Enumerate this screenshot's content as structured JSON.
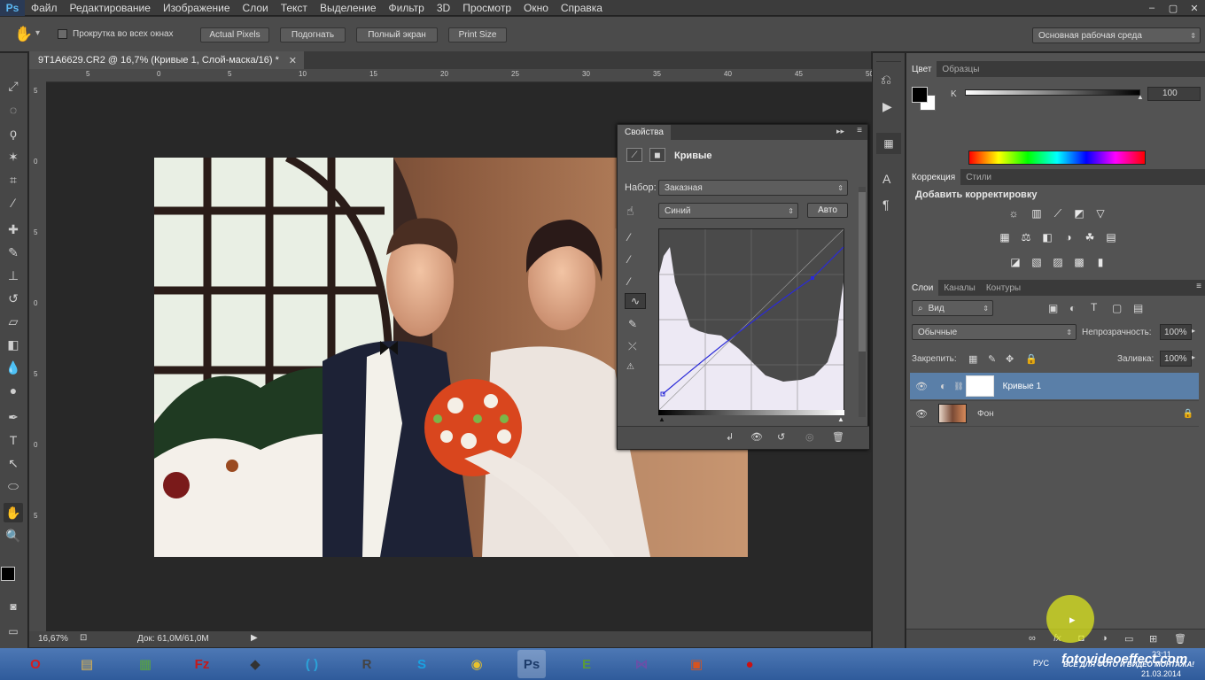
{
  "app": {
    "logo": "Ps"
  },
  "menu": [
    "Файл",
    "Редактирование",
    "Изображение",
    "Слои",
    "Текст",
    "Выделение",
    "Фильтр",
    "3D",
    "Просмотр",
    "Окно",
    "Справка"
  ],
  "window_controls": [
    "–",
    "▢",
    "✕"
  ],
  "options": {
    "scroll_all_label": "Прокрутка во всех окнах",
    "actual_pixels": "Actual Pixels",
    "fit": "Подогнать",
    "full_screen": "Полный экран",
    "print_size": "Print Size",
    "workspace": "Основная рабочая среда"
  },
  "document": {
    "tab_title": "9T1A6629.CR2 @ 16,7% (Кривые 1, Слой-маска/16) *",
    "ruler_top": [
      "5",
      "0",
      "5",
      "10",
      "15",
      "20",
      "25",
      "30",
      "35",
      "40",
      "45",
      "50"
    ],
    "ruler_left": [
      "5",
      "0",
      "5",
      "0",
      "5",
      "0",
      "5"
    ]
  },
  "status": {
    "zoom": "16,67%",
    "doc": "Док: 61,0M/61,0M"
  },
  "properties": {
    "tab": "Свойства",
    "title": "Кривые",
    "preset_label": "Набор:",
    "preset_value": "Заказная",
    "channel_value": "Синий",
    "auto_label": "Авто"
  },
  "color_panel": {
    "tabs": [
      "Цвет",
      "Образцы"
    ],
    "channel_label": "K",
    "value": "100"
  },
  "adjustments_panel": {
    "tabs": [
      "Коррекция",
      "Стили"
    ],
    "title": "Добавить корректировку"
  },
  "layers_panel": {
    "tabs": [
      "Слои",
      "Каналы",
      "Контуры"
    ],
    "filter_kind": "Вид",
    "blend_mode": "Обычные",
    "opacity_label": "Непрозрачность:",
    "opacity_value": "100%",
    "lock_label": "Закрепить:",
    "fill_label": "Заливка:",
    "fill_value": "100%",
    "layers": [
      {
        "name": "Кривые 1"
      },
      {
        "name": "Фон"
      }
    ]
  },
  "taskbar": {
    "apps": [
      {
        "icon": "opera-icon",
        "glyph": "O",
        "color": "#d81c1c"
      },
      {
        "icon": "explorer-icon",
        "glyph": "▤",
        "color": "#e8b84a"
      },
      {
        "icon": "charts-icon",
        "glyph": "▦",
        "color": "#5aa63a"
      },
      {
        "icon": "filezilla-icon",
        "glyph": "Fz",
        "color": "#c41a1a"
      },
      {
        "icon": "app-dark-icon",
        "glyph": "◆",
        "color": "#333333"
      },
      {
        "icon": "brackets-icon",
        "glyph": "( )",
        "color": "#2aa3d9"
      },
      {
        "icon": "r-app-icon",
        "glyph": "R",
        "color": "#444444"
      },
      {
        "icon": "skype-icon",
        "glyph": "S",
        "color": "#1aa1e1"
      },
      {
        "icon": "chrome-icon",
        "glyph": "◉",
        "color": "#e8c22b"
      },
      {
        "icon": "photoshop-icon",
        "glyph": "Ps",
        "color": "#1d3c6b"
      },
      {
        "icon": "evernote-icon",
        "glyph": "E",
        "color": "#5a9a3a"
      },
      {
        "icon": "vs-icon",
        "glyph": "⋈",
        "color": "#6b4fa8"
      },
      {
        "icon": "slides-icon",
        "glyph": "▣",
        "color": "#d9531e"
      },
      {
        "icon": "record-icon",
        "glyph": "●",
        "color": "#cc1111"
      }
    ],
    "tray_lang": "РУС",
    "clock_time": "23:11",
    "clock_date": "21.03.2014"
  },
  "watermark": {
    "title": "fotovideoeffect.com",
    "subtitle": "ВСЕ ДЛЯ ФОТО И ВИДЕО МОНТАЖА!"
  },
  "colors": {
    "accent": "#5a7fa8",
    "bg": "#282828",
    "panel": "#535353"
  }
}
